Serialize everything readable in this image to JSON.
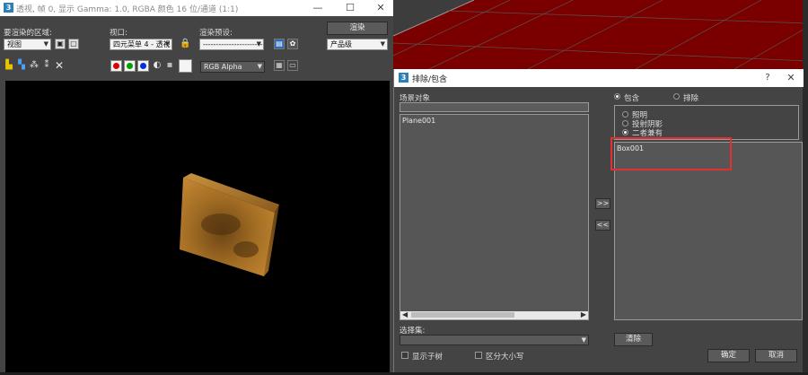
{
  "render_window": {
    "title": "透视, 帧 0, 显示 Gamma: 1.0, RGBA 颜色 16 位/通道 (1:1)",
    "area_label": "要渲染的区域:",
    "area_value": "视图",
    "viewport_label": "视口:",
    "viewport_value": "四元菜单 4 - 透视",
    "preset_label": "渲染预设:",
    "preset_value": "-------------------------",
    "render_button": "渲染",
    "quality_value": "产品级",
    "channel_value": "RGB Alpha",
    "controls": {
      "minimize": "—",
      "maximize": "☐",
      "close": "✕"
    }
  },
  "dialog": {
    "title": "排除/包含",
    "help": "?",
    "close": "✕",
    "scene_objects_label": "场景对象",
    "scene_search_value": "",
    "scene_objects": [
      "Plane001"
    ],
    "mode_options": [
      {
        "label": "包含",
        "selected": true
      },
      {
        "label": "排除",
        "selected": false
      }
    ],
    "type_options": [
      {
        "label": "照明",
        "selected": false
      },
      {
        "label": "投射阴影",
        "selected": false
      },
      {
        "label": "二者兼有",
        "selected": true
      }
    ],
    "included_objects": [
      "Box001"
    ],
    "add_button": ">>",
    "remove_button": "<<",
    "selection_set_label": "选择集:",
    "selection_set_value": "",
    "show_subtree_label": "显示子树",
    "case_sensitive_label": "区分大小写",
    "clear_button": "清除",
    "ok_button": "确定",
    "cancel_button": "取消"
  },
  "colors": {
    "highlight": "#e03030",
    "viewport_floor": "#7a0000",
    "brick_light": "#b87a2a",
    "brick_dark": "#5a3a10"
  }
}
